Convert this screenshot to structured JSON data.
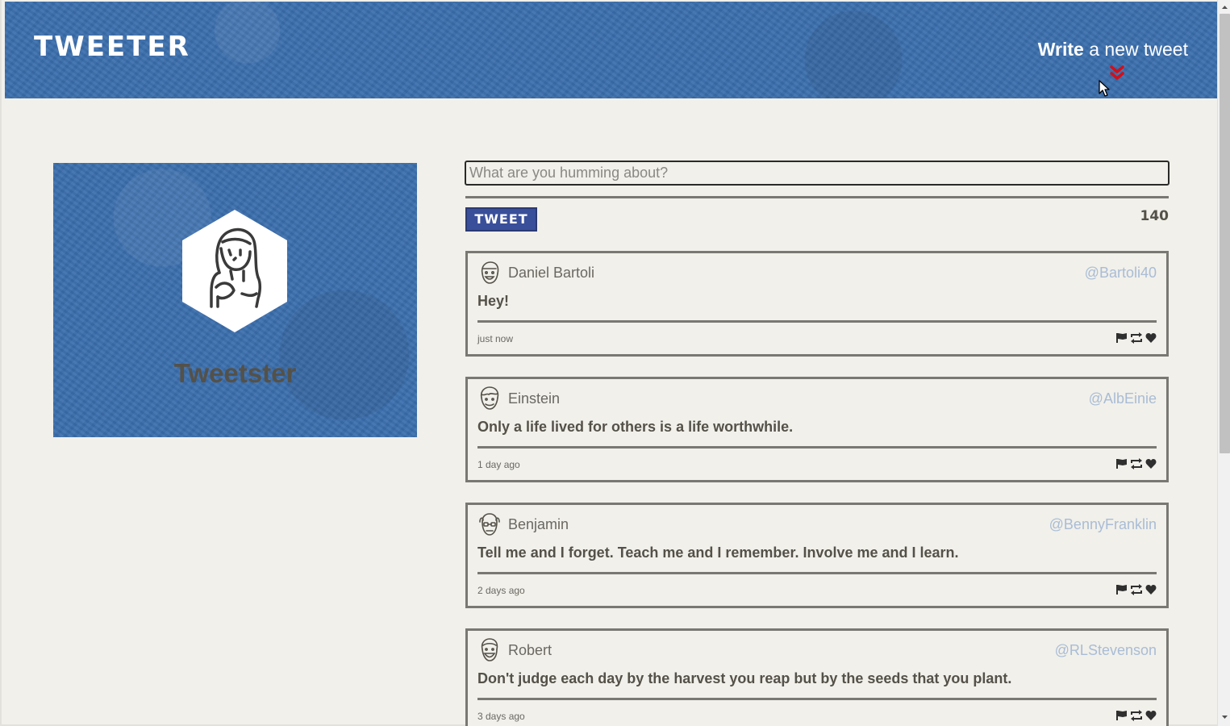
{
  "header": {
    "logo": "TWEETER",
    "compose_bold": "Write",
    "compose_rest": " a new tweet"
  },
  "profile": {
    "name": "Tweetster"
  },
  "composer": {
    "placeholder": "What are you humming about?",
    "button_label": "TWEET",
    "counter": "140"
  },
  "tweets": [
    {
      "name": "Daniel Bartoli",
      "handle": "@Bartoli40",
      "content": "Hey!",
      "time": "just now"
    },
    {
      "name": "Einstein",
      "handle": "@AlbEinie",
      "content": "Only a life lived for others is a life worthwhile.",
      "time": "1 day ago"
    },
    {
      "name": "Benjamin",
      "handle": "@BennyFranklin",
      "content": "Tell me and I forget. Teach me and I remember. Involve me and I learn.",
      "time": "2 days ago"
    },
    {
      "name": "Robert",
      "handle": "@RLStevenson",
      "content": "Don't judge each day by the harvest you reap but by the seeds that you plant.",
      "time": "3 days ago"
    }
  ],
  "icons": {
    "compose": "double-chevron-down-icon",
    "actions": [
      "flag-icon",
      "retweet-icon",
      "heart-icon"
    ]
  },
  "colors": {
    "header_bg": "#3b6ead",
    "page_bg": "#f1f0ea",
    "text": "#545149",
    "handle": "#a9bcd6",
    "button_bg": "#3a4f9a",
    "compose_arrow": "#d0101b"
  }
}
